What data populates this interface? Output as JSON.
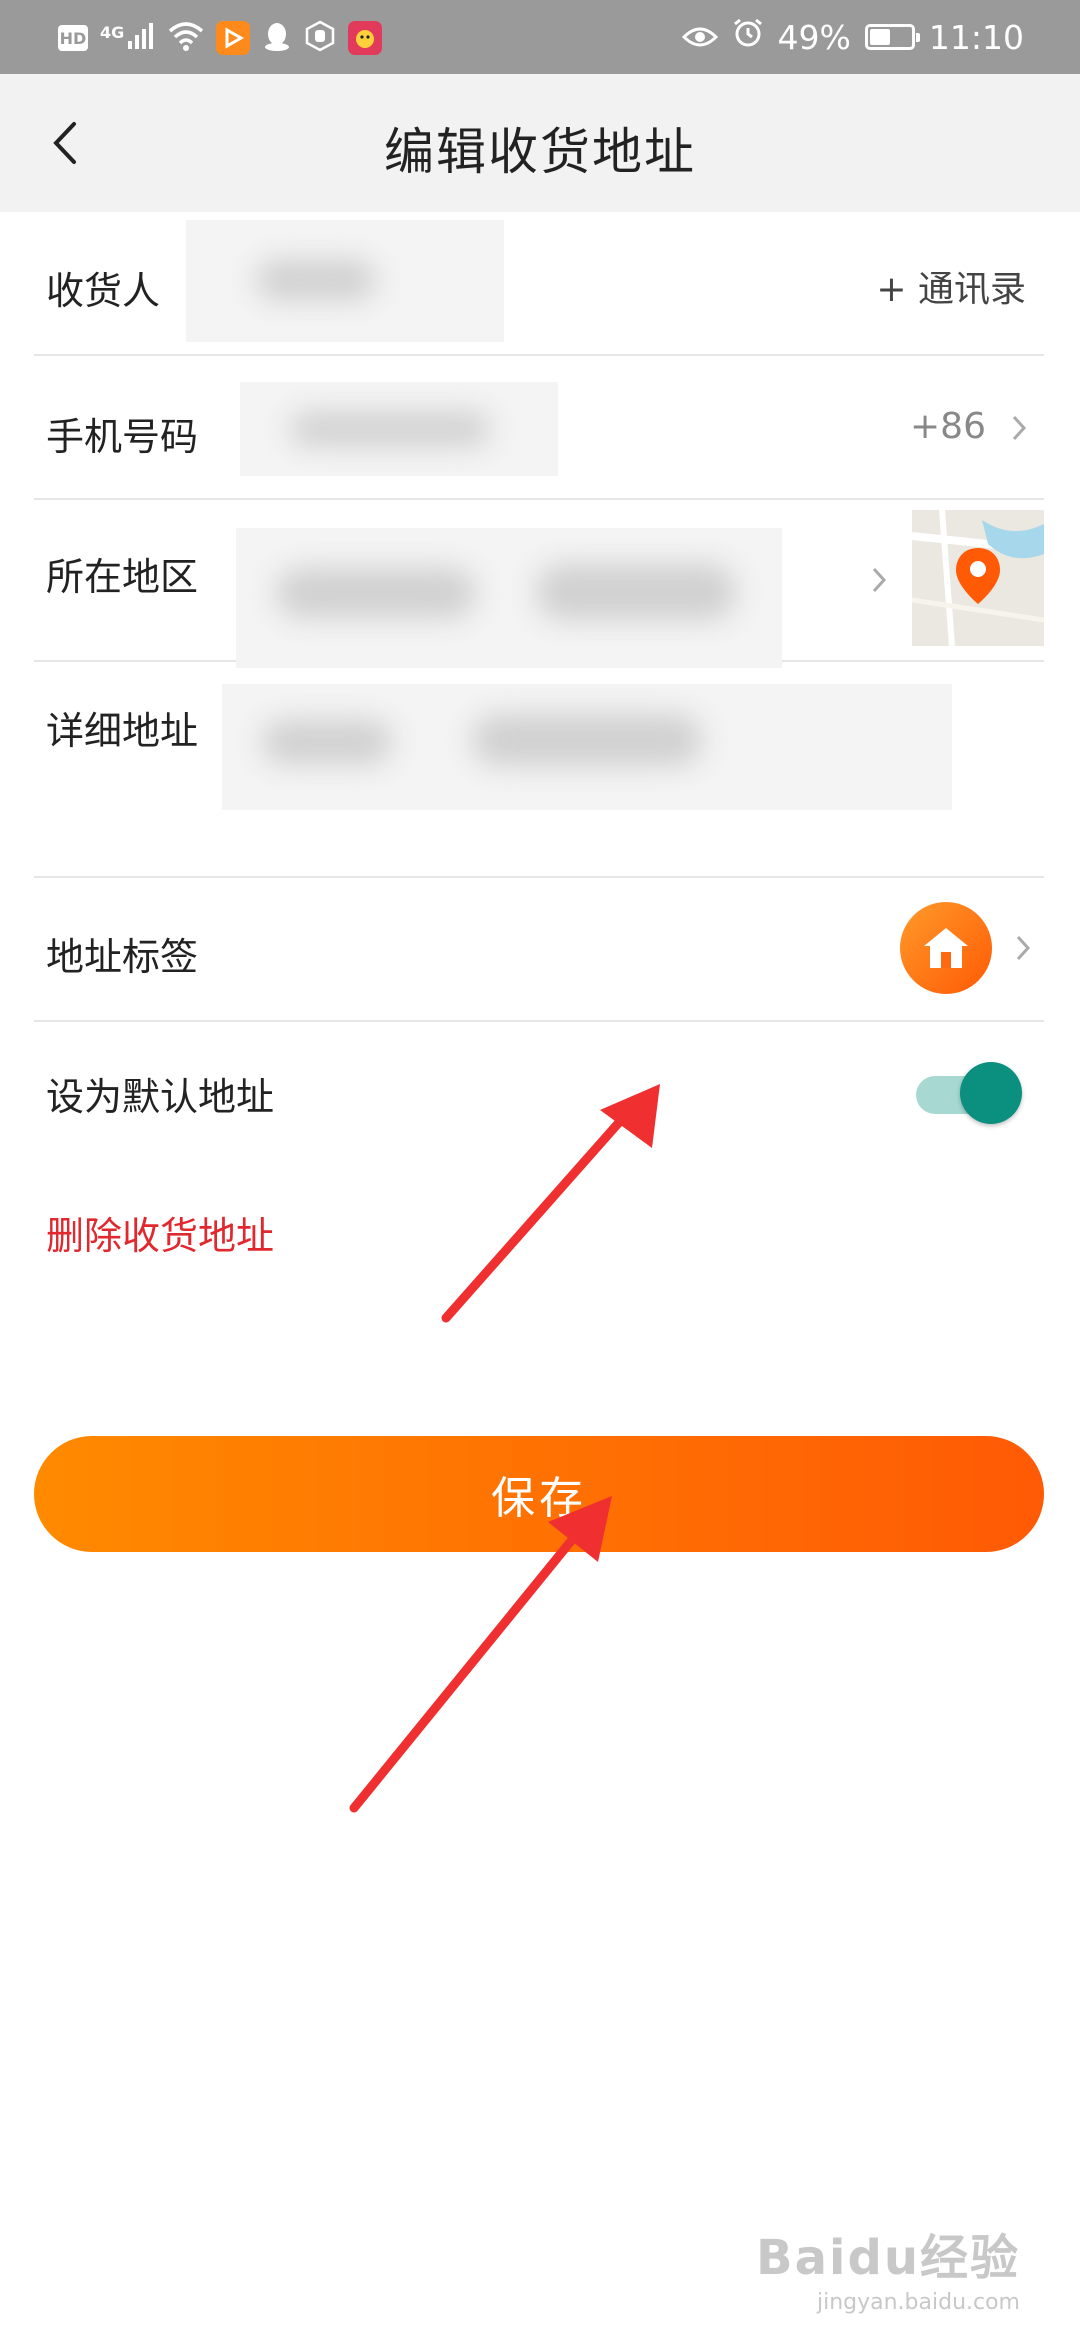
{
  "status_bar": {
    "hd_badge": "HD",
    "signal_label": "4G",
    "battery_text": "49%",
    "battery_level": 0.49,
    "time": "11:10"
  },
  "nav": {
    "title": "编辑收货地址"
  },
  "form": {
    "recipient": {
      "label": "收货人",
      "contacts_link": "+ 通讯录"
    },
    "phone": {
      "label": "手机号码",
      "country_code": "+86"
    },
    "region": {
      "label": "所在地区"
    },
    "detail": {
      "label": "详细地址"
    },
    "tag": {
      "label": "地址标签",
      "icon": "home-icon"
    },
    "default": {
      "label": "设为默认地址",
      "enabled": true
    }
  },
  "delete_label": "删除收货地址",
  "save_label": "保存",
  "watermark": {
    "main": "Baidu经验",
    "url": "jingyan.baidu.com"
  },
  "colors": {
    "accent_start": "#ff8a00",
    "accent_end": "#ff5a05",
    "delete": "#e0282e",
    "toggle_on": "#0b8f7f",
    "annotation_arrow": "#f03030"
  }
}
